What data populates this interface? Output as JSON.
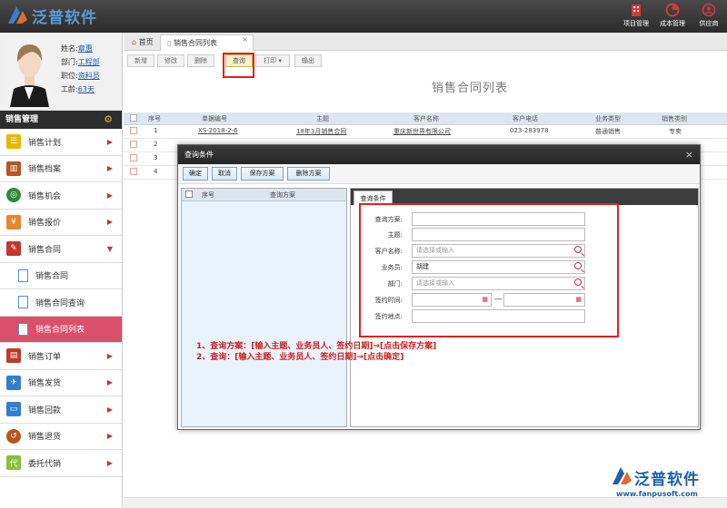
{
  "app": {
    "logo_text": "泛普软件",
    "nav": [
      {
        "label": "项目管理",
        "icon": "building-icon"
      },
      {
        "label": "成本管理",
        "icon": "pie-chart-icon"
      },
      {
        "label": "供应商",
        "icon": "supplier-icon"
      }
    ]
  },
  "profile": {
    "name_label": "姓名:",
    "name": "章惠",
    "dept_label": "部门:",
    "dept": "工程部",
    "title_label": "职位:",
    "title": "资料员",
    "age_label": "工龄:",
    "age": "63天"
  },
  "sidebar": {
    "header": "销售管理",
    "items": [
      {
        "label": "销售计划",
        "icon": "plan-icon",
        "color": "#e8b800"
      },
      {
        "label": "销售档案",
        "icon": "archive-icon",
        "color": "#b8551b"
      },
      {
        "label": "销售机会",
        "icon": "target-icon",
        "color": "#2e8b3a"
      },
      {
        "label": "销售报价",
        "icon": "price-tag-icon",
        "color": "#e8862a"
      },
      {
        "label": "销售合同",
        "icon": "contract-icon",
        "color": "#c0392b"
      },
      {
        "label": "销售合同",
        "icon": "document-icon"
      },
      {
        "label": "销售合同查询",
        "icon": "document-icon"
      },
      {
        "label": "销售合同列表",
        "icon": "document-icon"
      },
      {
        "label": "销售订单",
        "icon": "order-icon",
        "color": "#c0392b"
      },
      {
        "label": "销售发货",
        "icon": "plane-icon",
        "color": "#2f7fd1"
      },
      {
        "label": "销售回款",
        "icon": "payment-icon",
        "color": "#2f7fd1"
      },
      {
        "label": "销售退货",
        "icon": "return-icon",
        "color": "#b8551b"
      },
      {
        "label": "委托代销",
        "icon": "consign-icon",
        "color": "#8dbf3a"
      }
    ]
  },
  "tabs": {
    "home": "首页",
    "current": "销售合同列表"
  },
  "toolbar": {
    "new": "新增",
    "edit": "修改",
    "delete": "删除",
    "query": "查询",
    "print": "打印",
    "export": "输出"
  },
  "page_title": "销售合同列表",
  "grid": {
    "headers": [
      "序号",
      "单据编号",
      "主题",
      "客户名称",
      "客户电话",
      "业务类型",
      "销售类别"
    ],
    "rows": [
      {
        "no": "1",
        "code": "XS-2018-2-6",
        "subject": "18年3月销售合同",
        "customer": "重庆新世界有限公司",
        "phone": "023-283978",
        "biz": "普通销售",
        "cat": "专卖"
      },
      {
        "no": "2"
      },
      {
        "no": "3"
      },
      {
        "no": "4"
      }
    ]
  },
  "dialog": {
    "title": "查询条件",
    "buttons": {
      "ok": "确定",
      "cancel": "取消",
      "save": "保存方案",
      "delete": "删除方案"
    },
    "left_headers": {
      "no": "序号",
      "scheme": "查询方案"
    },
    "right_tab": "查询条件",
    "fields": {
      "scheme": {
        "label": "查询方案:",
        "value": ""
      },
      "subject": {
        "label": "主题:",
        "value": ""
      },
      "customer": {
        "label": "客户名称:",
        "placeholder": "请选择或输入"
      },
      "salesman": {
        "label": "业务员:",
        "value": "胡建"
      },
      "dept": {
        "label": "部门:",
        "placeholder": "请选择或输入"
      },
      "sign_date": {
        "label": "签约时间:",
        "separator": "—"
      },
      "sign_place": {
        "label": "签约地点:",
        "value": ""
      }
    }
  },
  "notes": [
    "1、查询方案：[输入主题、业务员人、签约日期]→[点击保存方案]",
    "2、查询：[输入主题、业务员人、签约日期]→[点击确定]"
  ],
  "watermark": {
    "text": "泛普软件",
    "url": "www.fanpusoft.com"
  },
  "colors": {
    "accent": "#d9506a",
    "topbar": "#2b2b2b",
    "annotation_red": "#e02020"
  }
}
